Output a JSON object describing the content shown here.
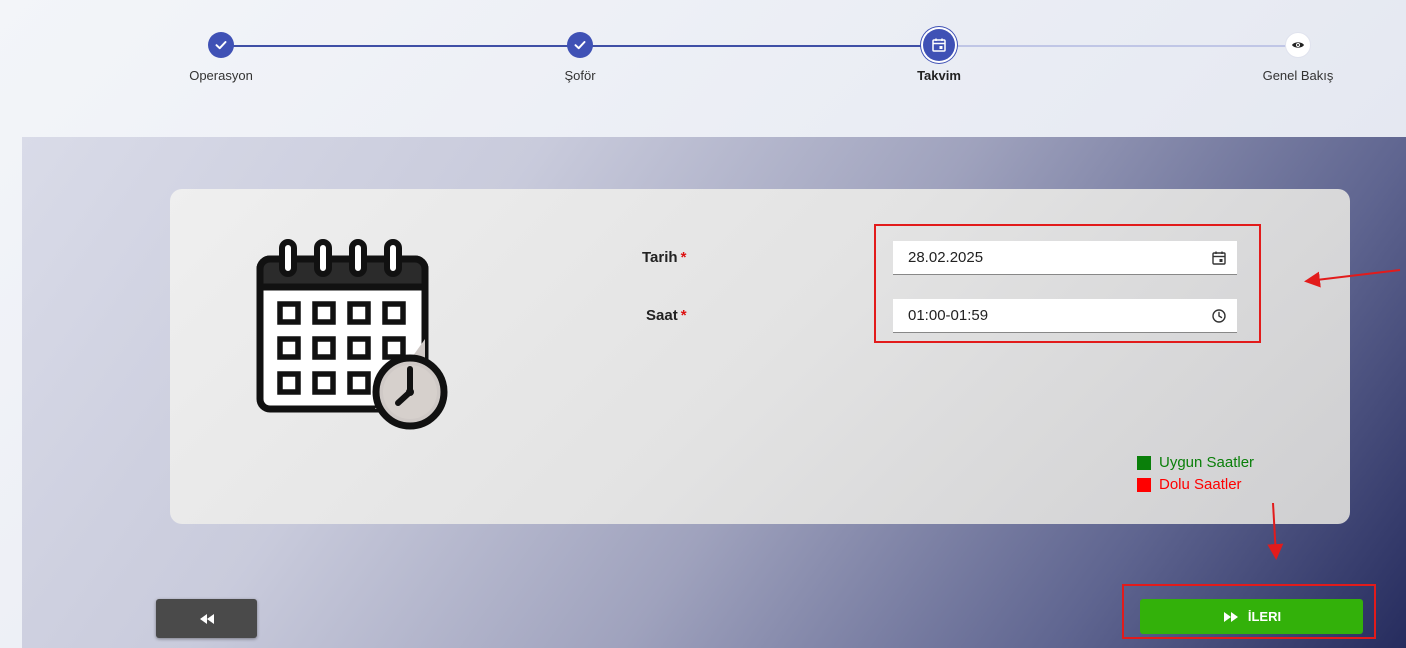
{
  "stepper": {
    "steps": [
      {
        "label": "Operasyon",
        "state": "done",
        "icon": "check-icon"
      },
      {
        "label": "Şoför",
        "state": "done",
        "icon": "check-icon"
      },
      {
        "label": "Takvim",
        "state": "active",
        "icon": "calendar-icon"
      },
      {
        "label": "Genel Bakış",
        "state": "todo",
        "icon": "eye-icon"
      }
    ]
  },
  "form": {
    "date_label": "Tarih",
    "date_value": "28.02.2025",
    "time_label": "Saat",
    "time_value": "01:00-01:59",
    "required_mark": "*"
  },
  "legend": {
    "available": {
      "label": "Uygun Saatler",
      "color": "#0a8a0a"
    },
    "busy": {
      "label": "Dolu Saatler",
      "color": "#ff0000"
    }
  },
  "buttons": {
    "back_icon": "rewind-icon",
    "next_label": "İLERI",
    "next_icon": "fast-forward-icon"
  },
  "colors": {
    "primary": "#3f51b5",
    "next_button": "#33b10a",
    "highlight": "#e21b1b"
  }
}
